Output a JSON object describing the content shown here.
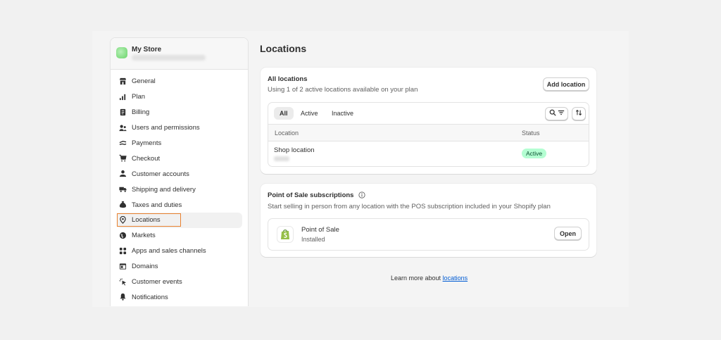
{
  "store": {
    "name": "My Store"
  },
  "sidebar": {
    "items": [
      {
        "label": "General",
        "icon": "store-icon"
      },
      {
        "label": "Plan",
        "icon": "chart-icon"
      },
      {
        "label": "Billing",
        "icon": "receipt-icon"
      },
      {
        "label": "Users and permissions",
        "icon": "users-icon"
      },
      {
        "label": "Payments",
        "icon": "payments-icon"
      },
      {
        "label": "Checkout",
        "icon": "cart-icon"
      },
      {
        "label": "Customer accounts",
        "icon": "person-icon"
      },
      {
        "label": "Shipping and delivery",
        "icon": "truck-icon"
      },
      {
        "label": "Taxes and duties",
        "icon": "tax-icon"
      },
      {
        "label": "Locations",
        "icon": "location-pin-icon"
      },
      {
        "label": "Markets",
        "icon": "globe-icon"
      },
      {
        "label": "Apps and sales channels",
        "icon": "apps-icon"
      },
      {
        "label": "Domains",
        "icon": "domains-icon"
      },
      {
        "label": "Customer events",
        "icon": "cursor-icon"
      },
      {
        "label": "Notifications",
        "icon": "bell-icon"
      }
    ],
    "active_label": "Locations"
  },
  "page": {
    "title": "Locations"
  },
  "locations_card": {
    "title": "All locations",
    "subtitle": "Using 1 of 2 active locations available on your plan",
    "add_button": "Add location",
    "tabs": [
      "All",
      "Active",
      "Inactive"
    ],
    "columns": {
      "location": "Location",
      "status": "Status"
    },
    "rows": [
      {
        "name": "Shop location",
        "status": "Active"
      }
    ]
  },
  "pos_card": {
    "title": "Point of Sale subscriptions",
    "subtitle": "Start selling in person from any location with the POS subscription included in your Shopify plan",
    "app_name": "Point of Sale",
    "app_status": "Installed",
    "open_button": "Open"
  },
  "footer": {
    "text": "Learn more about",
    "link": "locations"
  },
  "colors": {
    "accent_highlight": "#e8812f",
    "active_badge": "#b4fed2",
    "link": "#005bd3"
  }
}
